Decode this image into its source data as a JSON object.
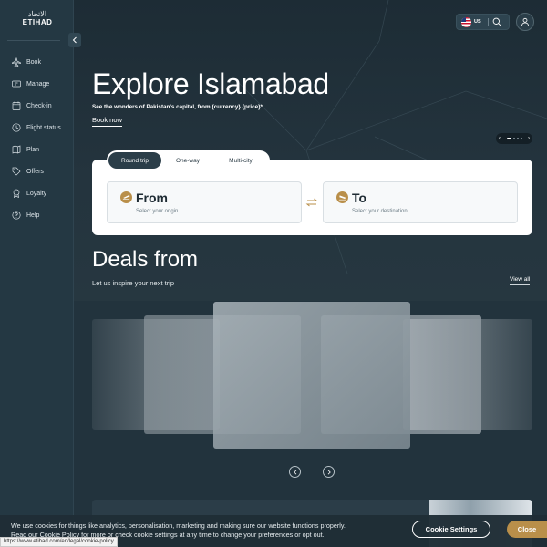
{
  "brand": {
    "logo_arabic": "الاتحاد",
    "logo_english": "ETIHAD"
  },
  "sidebar": {
    "items": [
      {
        "label": "Book",
        "icon": "plane-icon"
      },
      {
        "label": "Manage",
        "icon": "ticket-icon"
      },
      {
        "label": "Check-in",
        "icon": "calendar-check-icon"
      },
      {
        "label": "Flight status",
        "icon": "clock-icon"
      },
      {
        "label": "Plan",
        "icon": "map-icon"
      },
      {
        "label": "Offers",
        "icon": "tag-icon"
      },
      {
        "label": "Loyalty",
        "icon": "badge-icon"
      },
      {
        "label": "Help",
        "icon": "help-icon"
      }
    ]
  },
  "header": {
    "country": "US"
  },
  "hero": {
    "title": "Explore Islamabad",
    "subtitle": "See the wonders of Pakistan's capital, from {currency} {price}*",
    "cta": "Book now",
    "slides": 4,
    "active_slide": 1
  },
  "booking": {
    "tabs": [
      "Round trip",
      "One-way",
      "Multi-city"
    ],
    "active_tab": "Round trip",
    "from_label": "From",
    "from_hint": "Select your origin",
    "to_label": "To",
    "to_hint": "Select your destination"
  },
  "deals": {
    "title": "Deals from",
    "subtitle": "Let us inspire your next trip",
    "view_all": "View all"
  },
  "cookie": {
    "text_1": "We use cookies for things like analytics, personalisation, marketing and making sure our website functions properly.",
    "text_2_link": "Read our Cookie Policy",
    "text_2_rest": " for more or check cookie settings at any time to change your preferences or opt out.",
    "settings_label": "Cookie Settings",
    "close_label": "Close"
  },
  "status_url": "https://www.etihad.com/en/legal/cookie-policy",
  "colors": {
    "accent": "#b98f4a",
    "dark": "#22333d",
    "sidebar": "#243843"
  }
}
